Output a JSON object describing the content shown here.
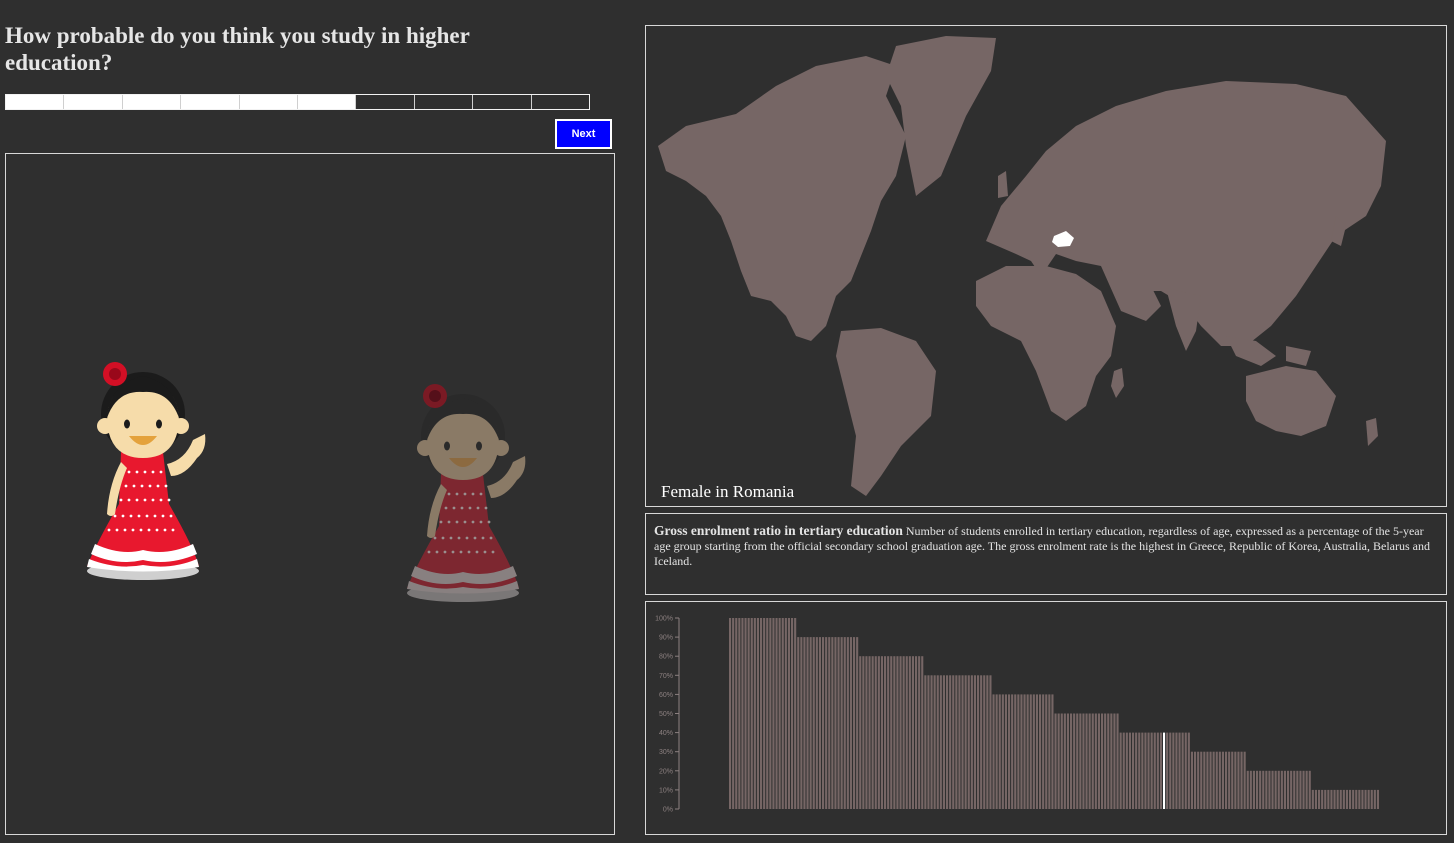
{
  "question": {
    "text": "How probable do you think you study in higher education?"
  },
  "progress": {
    "total_steps": 10,
    "completed_steps": 6
  },
  "next_button": {
    "label": "Next"
  },
  "characters": [
    {
      "name": "female-character",
      "state": "highlighted"
    },
    {
      "name": "female-character-darker",
      "state": "dimmed"
    }
  ],
  "map": {
    "label": "Female in Romania",
    "highlighted_country": "Romania",
    "land_color": "#766665",
    "highlight_color": "#ffffff"
  },
  "description": {
    "title": "Gross enrolment ratio in tertiary education",
    "text": "Number of students enrolled in tertiary education, regardless of age, expressed as a percentage of the 5-year age group starting from the official secondary school graduation age. The gross enrolment rate is the highest in Greece, Republic of Korea, Australia, Belarus and Iceland."
  },
  "chart_data": {
    "type": "bar",
    "title": "",
    "xlabel": "",
    "ylabel": "",
    "ylim": [
      0,
      100
    ],
    "y_ticks": [
      "0%",
      "10%",
      "20%",
      "30%",
      "40%",
      "50%",
      "60%",
      "70%",
      "80%",
      "90%",
      "100%"
    ],
    "bar_color": "#766665",
    "highlight_color": "#ffffff",
    "groups": [
      {
        "value": 100,
        "count": 22
      },
      {
        "value": 90,
        "count": 20
      },
      {
        "value": 80,
        "count": 21
      },
      {
        "value": 70,
        "count": 22
      },
      {
        "value": 60,
        "count": 20
      },
      {
        "value": 50,
        "count": 21
      },
      {
        "value": 40,
        "count": 23
      },
      {
        "value": 30,
        "count": 18
      },
      {
        "value": 20,
        "count": 21
      },
      {
        "value": 10,
        "count": 22
      }
    ],
    "highlight_index": 140
  }
}
